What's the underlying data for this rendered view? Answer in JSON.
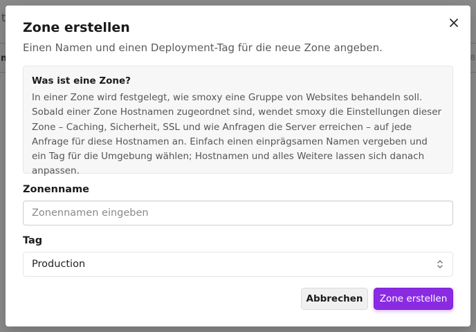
{
  "background": {
    "left_top_fragment": "t",
    "left_mid_fragment": "m",
    "right_mid_fragment": "8"
  },
  "dialog": {
    "title": "Zone erstellen",
    "subtitle": "Einen Namen und einen Deployment-Tag für die neue Zone angeben.",
    "close_icon": "close-icon",
    "info": {
      "title": "Was ist eine Zone?",
      "text": "In einer Zone wird festgelegt, wie smoxy eine Gruppe von Websites behandeln soll. Sobald einer Zone Hostnamen zugeordnet sind, wendet smoxy die Einstellungen dieser Zone – Caching, Sicherheit, SSL und wie Anfragen die Server erreichen – auf jede Anfrage für diese Hostnamen an. Einfach einen einprägsamen Namen vergeben und ein Tag für die Umgebung wählen; Hostnamen und alles Weitere lassen sich danach anpassen."
    },
    "zone_name": {
      "label": "Zonenname",
      "value": "",
      "placeholder": "Zonennamen eingeben"
    },
    "tag": {
      "label": "Tag",
      "selected": "Production",
      "icon": "chevron-up-down-icon"
    },
    "buttons": {
      "cancel_label": "Abbrechen",
      "create_label": "Zone erstellen"
    }
  },
  "colors": {
    "accent": "#8a2be2",
    "backdrop": "#8a8a8a"
  }
}
